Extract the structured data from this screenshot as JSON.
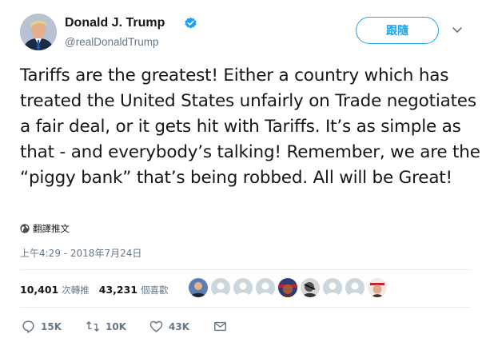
{
  "author": {
    "name": "Donald J. Trump",
    "handle": "@realDonaldTrump",
    "verified": true
  },
  "follow_button": {
    "label": "跟隨"
  },
  "tweet": {
    "text": "Tariffs are the greatest! Either a country which has treated the United States unfairly on Trade negotiates a fair deal, or it gets hit with Tariffs. It’s as simple as that - and everybody’s talking! Remember, we are the “piggy bank” that’s being robbed. All will be Great!",
    "translate_label": "翻譯推文",
    "timestamp": "上午4:29 - 2018年7月24日"
  },
  "stats": {
    "retweets": {
      "count": "10,401",
      "label": "次轉推"
    },
    "likes": {
      "count": "43,231",
      "label": "個喜歡"
    }
  },
  "actions": {
    "reply": {
      "count": "15K",
      "icon": "reply-icon"
    },
    "retweet": {
      "count": "10K",
      "icon": "retweet-icon"
    },
    "like": {
      "count": "43K",
      "icon": "heart-icon"
    },
    "message": {
      "icon": "envelope-icon"
    }
  },
  "colors": {
    "accent": "#1da1f2",
    "text": "#14171a",
    "muted": "#657786",
    "divider": "#e6ecf0"
  }
}
